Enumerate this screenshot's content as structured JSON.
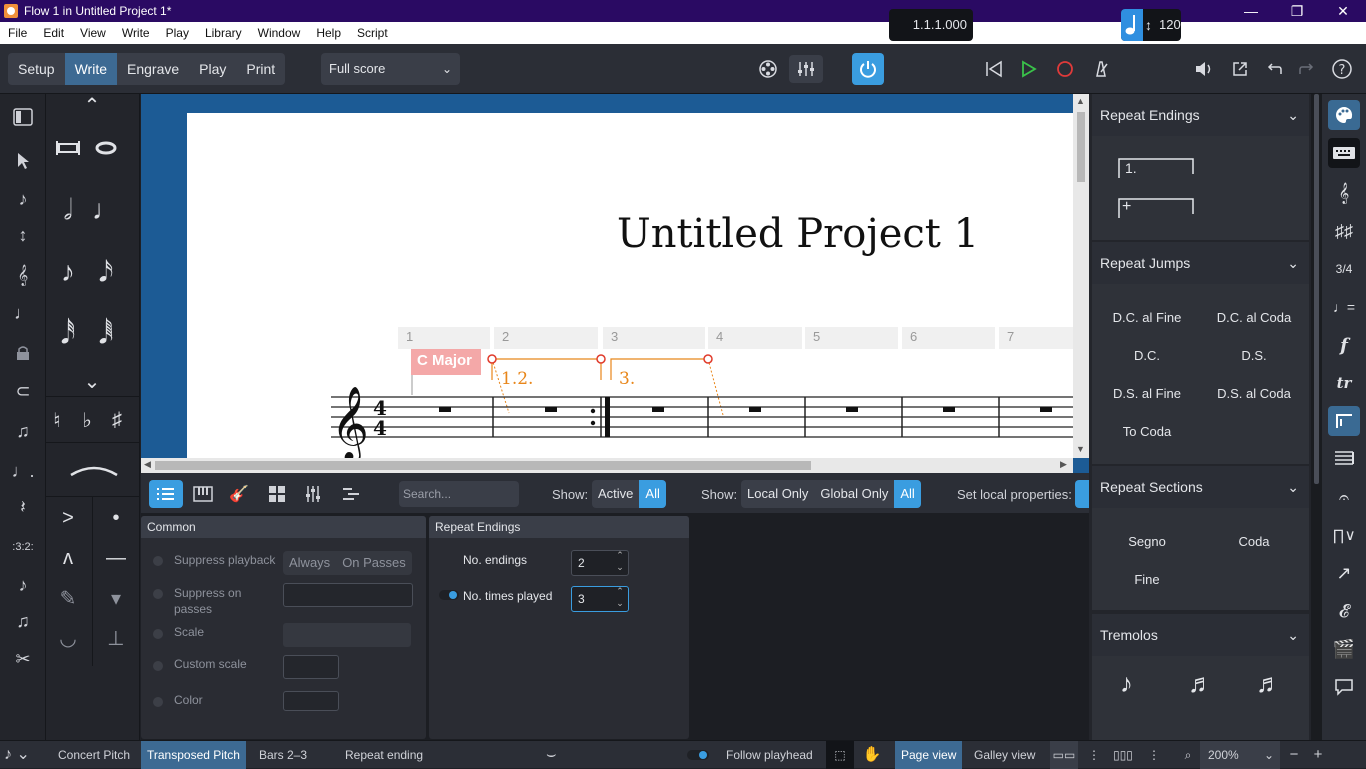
{
  "window": {
    "title": "Flow 1 in Untitled Project 1*",
    "minimize": "—",
    "maximize": "❐",
    "close": "✕"
  },
  "menu": [
    "File",
    "Edit",
    "View",
    "Write",
    "Play",
    "Library",
    "Window",
    "Help",
    "Script"
  ],
  "modes": [
    {
      "label": "Setup",
      "selected": false
    },
    {
      "label": "Write",
      "selected": true
    },
    {
      "label": "Engrave",
      "selected": false
    },
    {
      "label": "Play",
      "selected": false
    },
    {
      "label": "Print",
      "selected": false
    }
  ],
  "layout_select": {
    "value": "Full score"
  },
  "transport": {
    "position": "1.1.1.000",
    "tempo": "120"
  },
  "score": {
    "title": "Untitled Project 1",
    "bar_numbers": [
      "1",
      "2",
      "3",
      "4",
      "5",
      "6",
      "7"
    ],
    "key_signal": "C Major",
    "ending1": "1.2.",
    "ending2": "3."
  },
  "lower_bar": {
    "search_placeholder": "Search...",
    "show1_label": "Show:",
    "show1_options": [
      {
        "label": "Active",
        "on": false
      },
      {
        "label": "All",
        "on": true
      }
    ],
    "show2_label": "Show:",
    "show2_options": [
      {
        "label": "Local Only",
        "on": false
      },
      {
        "label": "Global Only",
        "on": false
      },
      {
        "label": "All",
        "on": true
      }
    ],
    "set_local_label": "Set local properties:"
  },
  "properties": {
    "common": {
      "header": "Common",
      "suppress_playback": "Suppress playback",
      "always": "Always",
      "on_passes": "On Passes",
      "suppress_on_passes": "Suppress on passes",
      "scale": "Scale",
      "custom_scale": "Custom scale",
      "color": "Color"
    },
    "repeat_endings": {
      "header": "Repeat Endings",
      "no_endings_label": "No. endings",
      "no_endings_value": "2",
      "times_played_label": "No. times played",
      "times_played_value": "3"
    }
  },
  "right_panel": {
    "repeat_endings": {
      "header": "Repeat Endings",
      "items": [
        "1.",
        "+"
      ]
    },
    "repeat_jumps": {
      "header": "Repeat Jumps",
      "items": [
        "D.C. al Fine",
        "D.C. al Coda",
        "D.C.",
        "D.S.",
        "D.S. al Fine",
        "D.S. al Coda",
        "To Coda"
      ]
    },
    "repeat_sections": {
      "header": "Repeat Sections",
      "items": [
        "Segno",
        "Coda",
        "Fine"
      ]
    },
    "tremolos": {
      "header": "Tremolos"
    }
  },
  "status_bar": {
    "concert_pitch": "Concert Pitch",
    "transposed_pitch": "Transposed Pitch",
    "selection": "Bars 2–3",
    "selected_item": "Repeat ending",
    "follow_playhead": "Follow playhead",
    "page_view": "Page view",
    "galley_view": "Galley view",
    "zoom": "200%",
    "zoom_out": "−",
    "zoom_in": "+"
  },
  "colors": {
    "accent": "#3a9de0",
    "mode_selected": "#3d6a93",
    "score_background": "#1c5b95",
    "ending_color": "#e8861a",
    "titlebar": "#2a0a63"
  }
}
